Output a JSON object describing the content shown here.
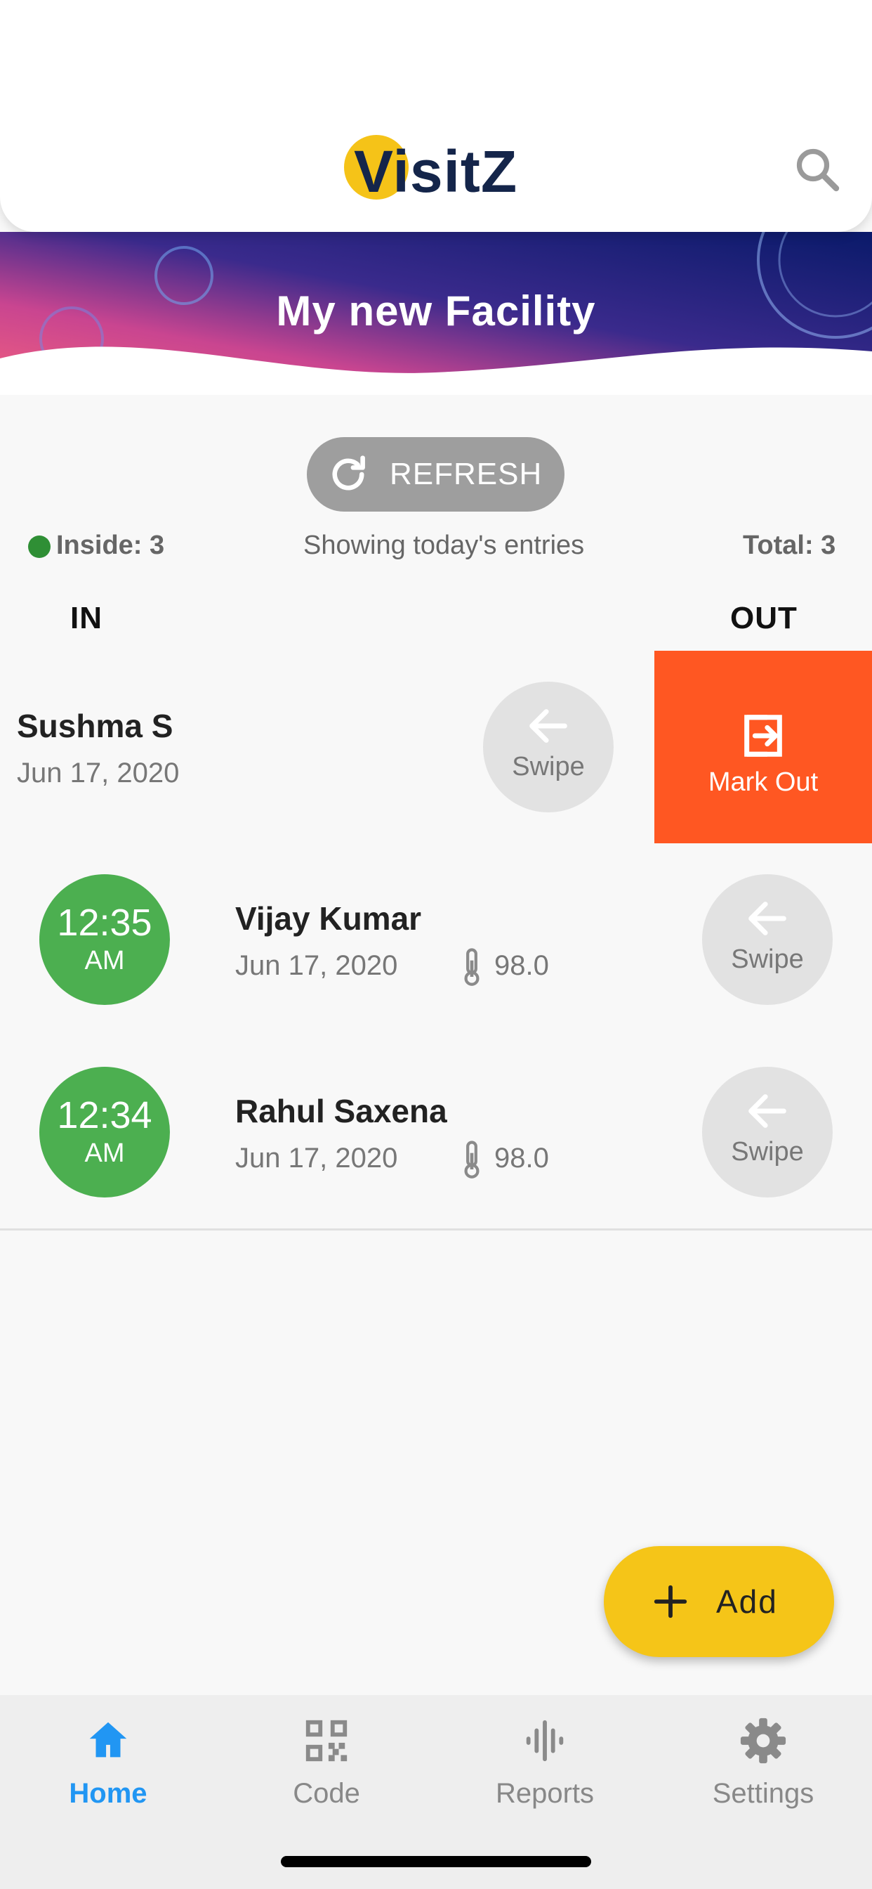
{
  "app": {
    "logo_text": "VisitZ"
  },
  "banner": {
    "title": "My new Facility"
  },
  "refresh": {
    "label": "REFRESH"
  },
  "stats": {
    "inside": "Inside: 3",
    "showing": "Showing today's entries",
    "total": "Total: 3"
  },
  "columns": {
    "in": "IN",
    "out": "OUT"
  },
  "swipe_label": "Swipe",
  "mark_out_label": "Mark Out",
  "entries": [
    {
      "name": "Sushma S",
      "date": "Jun 17, 2020"
    },
    {
      "time": "12:35",
      "ampm": "AM",
      "name": "Vijay Kumar",
      "date": "Jun 17, 2020",
      "temp": "98.0"
    },
    {
      "time": "12:34",
      "ampm": "AM",
      "name": "Rahul Saxena",
      "date": "Jun 17, 2020",
      "temp": "98.0"
    }
  ],
  "fab": {
    "label": "Add"
  },
  "nav": [
    {
      "label": "Home",
      "icon": "home-icon",
      "active": true
    },
    {
      "label": "Code",
      "icon": "qr-code-icon",
      "active": false
    },
    {
      "label": "Reports",
      "icon": "audio-wave-icon",
      "active": false
    },
    {
      "label": "Settings",
      "icon": "gear-icon",
      "active": false
    }
  ],
  "colors": {
    "green": "#4caf50",
    "orange": "#ff5722",
    "yellow": "#f5c518",
    "blue": "#2196f3"
  }
}
